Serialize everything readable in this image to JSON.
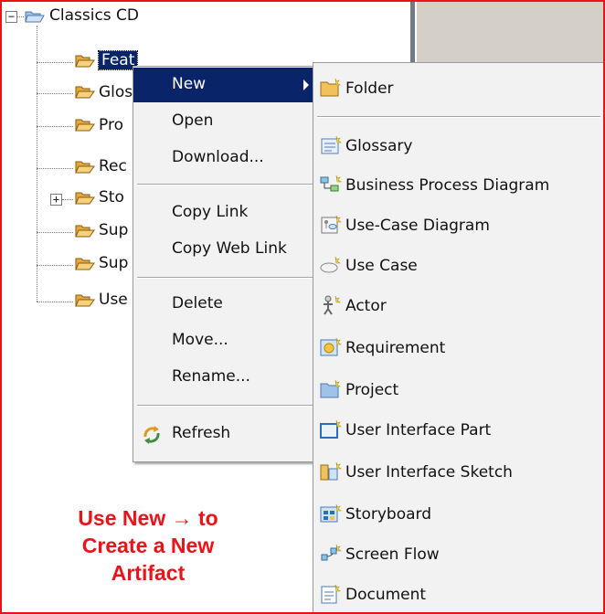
{
  "tree": {
    "root_label": "Classics CD",
    "items": [
      {
        "label": "Features",
        "visible": "Feat"
      },
      {
        "label": "Glos",
        "visible": "Glos"
      },
      {
        "label": "Pro",
        "visible": "Pro"
      },
      {
        "label": "Rec",
        "visible": "Rec"
      },
      {
        "label": "Sto",
        "visible": "Sto"
      },
      {
        "label": "Sup",
        "visible": "Sup"
      },
      {
        "label": "Sup",
        "visible": "Sup"
      },
      {
        "label": "Use",
        "visible": "Use"
      }
    ]
  },
  "context_menu": {
    "items": [
      "New",
      "Open",
      "Download...",
      "Copy Link",
      "Copy Web Link",
      "Delete",
      "Move...",
      "Rename...",
      "Refresh"
    ]
  },
  "submenu": {
    "items": [
      "Folder",
      "Glossary",
      "Business Process Diagram",
      "Use-Case Diagram",
      "Use Case",
      "Actor",
      "Requirement",
      "Project",
      "User Interface Part",
      "User Interface Sketch",
      "Storyboard",
      "Screen Flow",
      "Document"
    ]
  },
  "annotation": {
    "line1": "Use New → to",
    "line2": "Create a New",
    "line3": "Artifact"
  },
  "colors": {
    "highlight": "#0a246a",
    "annotation": "#e8141a",
    "folder": "#f2c15c"
  }
}
